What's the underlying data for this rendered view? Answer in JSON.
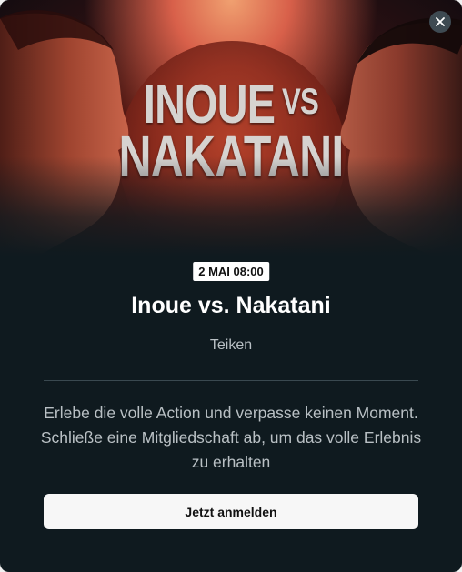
{
  "hero": {
    "title_line1": "INOUE",
    "title_vs": "VS",
    "title_line2": "NAKATANI"
  },
  "close_icon": "close-icon",
  "event": {
    "date_badge": "2 MAI 08:00",
    "title": "Inoue vs. Nakatani",
    "subtitle": "Teiken"
  },
  "description": "Erlebe die volle Action und verpasse keinen Moment. Schließe eine Mitgliedschaft ab, um das volle Erlebnis zu erhalten",
  "cta": {
    "label": "Jetzt anmelden"
  },
  "colors": {
    "background": "#0f1a1f",
    "accent_red": "#8f2d1e",
    "button": "#f7f7f7",
    "muted_text": "#b9c0c4"
  }
}
